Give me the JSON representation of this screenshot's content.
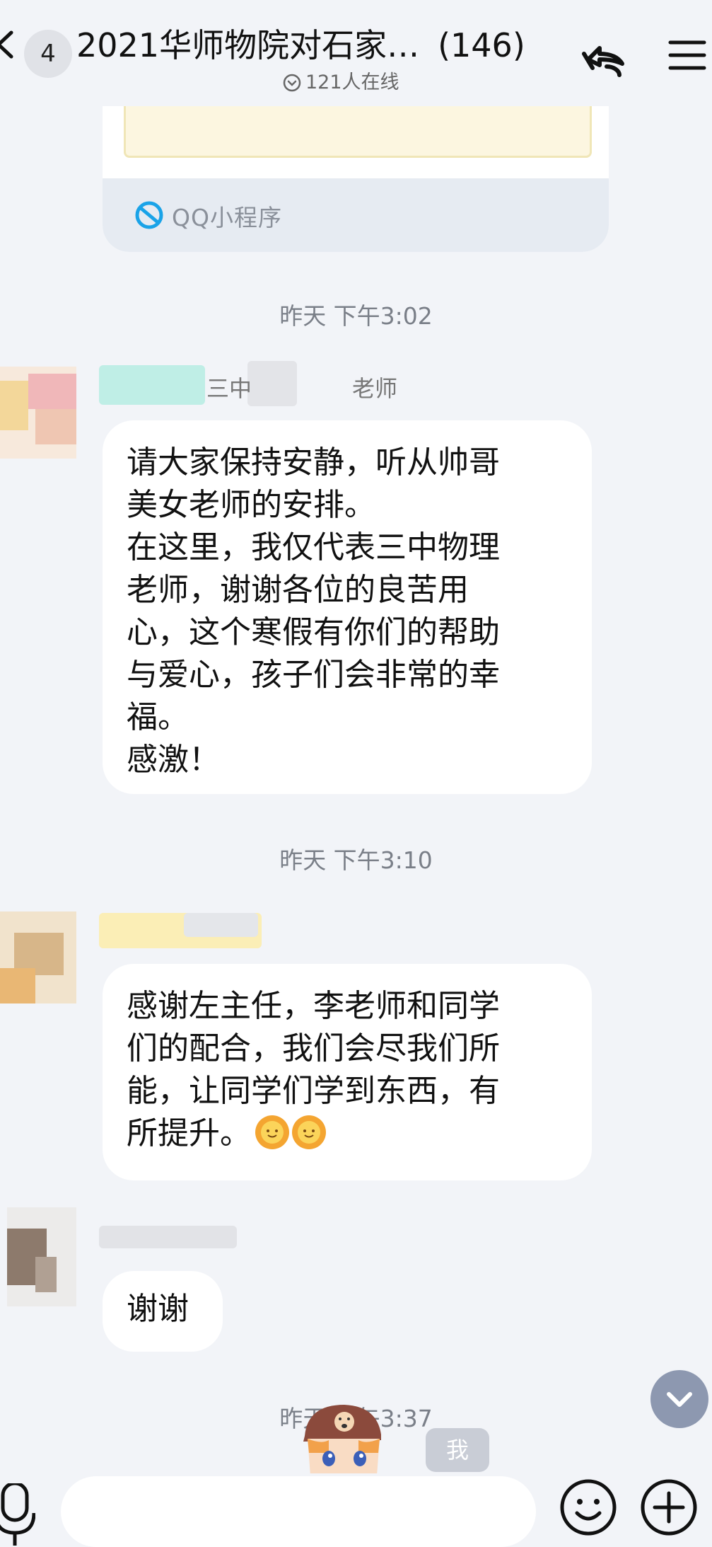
{
  "header": {
    "unread_count": "4",
    "title": "2021华师物院对石家…",
    "member_count": "(146)",
    "online_text": "121人在线"
  },
  "mini_program": {
    "label": "QQ小程序"
  },
  "timestamps": [
    "昨天 下午3:02",
    "昨天 下午3:10",
    "昨天 下午3:37"
  ],
  "messages": [
    {
      "sender_visible": "三中",
      "sender_suffix": "老师",
      "lines": [
        "请大家保持安静，听从帅哥",
        "美女老师的安排。",
        "在这里，我仅代表三中物理",
        "老师，谢谢各位的良苦用",
        "心，这个寒假有你们的帮助",
        "与爱心，孩子们会非常的幸",
        "福。",
        "感激！"
      ]
    },
    {
      "lines": [
        "感谢左主任，李老师和同学",
        "们的配合，我们会尽我们所",
        "能，让同学们学到东西，有",
        "所提升。"
      ],
      "emoji": [
        "sun-emoji",
        "sun-emoji"
      ]
    },
    {
      "lines": [
        "谢谢"
      ]
    }
  ],
  "me_label": "我",
  "input": {
    "value": "",
    "placeholder": ""
  },
  "icons": {
    "back": "chevron-left-icon",
    "settings": "share-icon",
    "menu": "menu-icon",
    "mic": "mic-icon",
    "emoji": "smiley-icon",
    "plus": "plus-icon",
    "scroll": "chevron-down-icon"
  },
  "colors": {
    "background": "#f2f4f8",
    "bubble": "#ffffff",
    "mini_program_footer": "#e6ebf2",
    "accent": "#1aa3e8"
  }
}
